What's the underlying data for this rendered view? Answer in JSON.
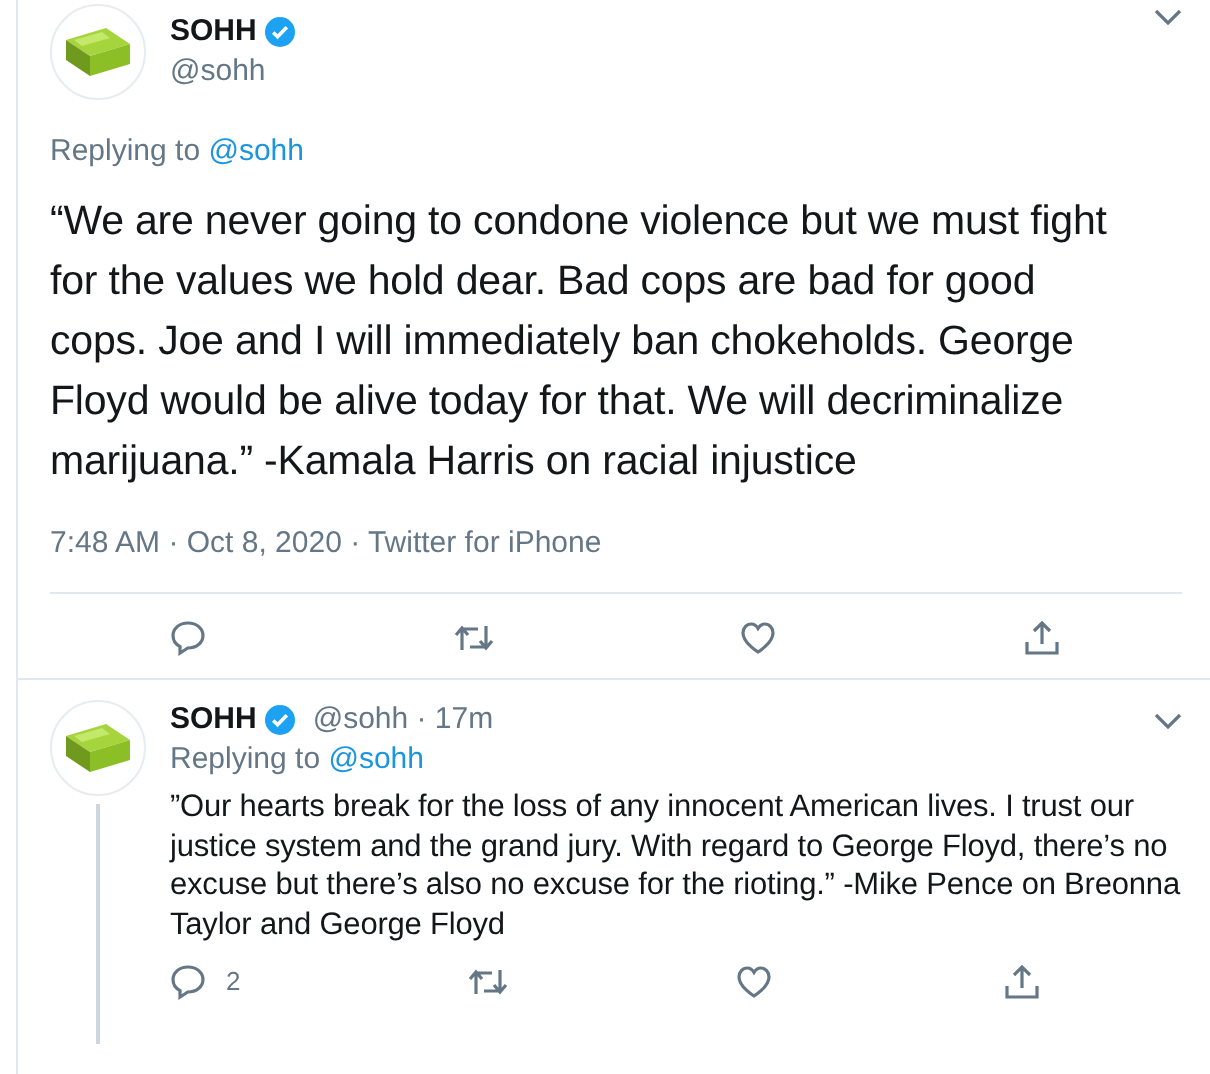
{
  "tweet": {
    "name": "SOHH",
    "verified": true,
    "handle": "@sohh",
    "replying_label": "Replying to",
    "replying_to": "@sohh",
    "text": "“We are never going to condone violence but we must fight for the values we hold dear. Bad cops are bad for good cops. Joe and I will immediately ban chokeholds. George Floyd would be alive today for that. We will decriminalize marijuana.” -Kamala Harris on racial injustice",
    "meta": "7:48 AM · Oct 8, 2020 · Twitter for iPhone",
    "actions": [
      {
        "kind": "reply"
      },
      {
        "kind": "retweet"
      },
      {
        "kind": "like"
      },
      {
        "kind": "share"
      }
    ]
  },
  "reply": {
    "name": "SOHH",
    "verified": true,
    "handle_time": "@sohh · 17m",
    "replying_label": "Replying to",
    "replying_to": "@sohh",
    "text": "”Our hearts break for the loss of any innocent American lives. I trust our justice system and the grand jury. With regard to George Floyd, there’s no excuse but there’s also no excuse for the rioting.” -Mike Pence on Breonna Taylor and George Floyd",
    "actions": [
      {
        "kind": "reply",
        "count": "2"
      },
      {
        "kind": "retweet"
      },
      {
        "kind": "like"
      },
      {
        "kind": "share"
      }
    ]
  }
}
